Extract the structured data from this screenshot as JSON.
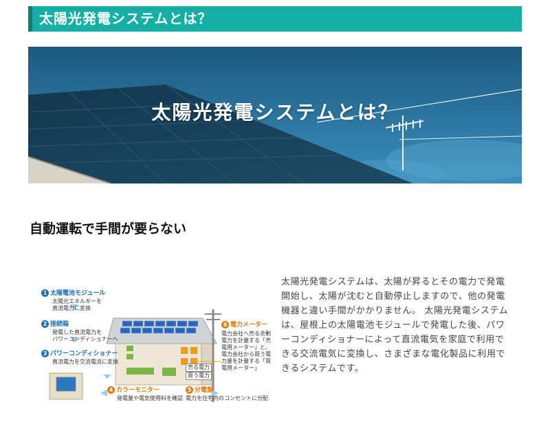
{
  "section_header": {
    "title": "太陽光発電システムとは？"
  },
  "hero": {
    "title": "太陽光発電システムとは？"
  },
  "feature": {
    "heading": "自動運転で手間が要らない",
    "description": "太陽光発電システムは、太陽が昇るとその電力で発電開始し、太陽が沈むと自動停止しますので、他の発電機器と違い手間がかかりません。 太陽光発電システムは、屋根上の太陽電池モジュールで発電した後、パワーコンディショナーによって直流電気を家庭で利用できる交流電気に変換し、さまざまな電化製品に利用できるシステムです。"
  },
  "diagram": {
    "items": [
      {
        "num": "1",
        "title": "太陽電池モジュール",
        "desc": [
          "太陽光エネルギーを",
          "直流電力に変換"
        ]
      },
      {
        "num": "2",
        "title": "接続箱",
        "desc": [
          "発電した直流電力を",
          "パワーコンディショナーへ"
        ]
      },
      {
        "num": "3",
        "title": "パワーコンディショナー",
        "desc": [
          "直流電力を交流電流に変換"
        ]
      },
      {
        "num": "4",
        "title": "カラーモニター",
        "desc": [
          "発電量や電気使用料を確認"
        ]
      },
      {
        "num": "5",
        "title": "分電盤",
        "desc": [
          "電力を住宅内のコンセントに分配"
        ]
      },
      {
        "num": "6",
        "title": "電力メーター",
        "desc": [
          "電力会社へ売る余剰",
          "電力を計量する「売",
          "電用メーター」と、",
          "電力会社から買う電",
          "力量を計量する「買",
          "電用メーター」"
        ]
      }
    ],
    "sell_label": "売る電力",
    "buy_label": "買う電力"
  },
  "colors": {
    "accent": "#16afa6",
    "accent_dark": "#0b7f78",
    "diagram_blue": "#1e6fb3",
    "diagram_orange": "#e07b10"
  }
}
